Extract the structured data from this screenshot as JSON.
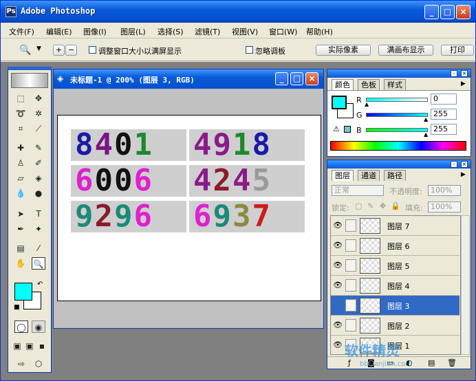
{
  "app": {
    "title": "Adobe Photoshop"
  },
  "menu": [
    "文件(F)",
    "编辑(E)",
    "图像(I)",
    "图层(L)",
    "选择(S)",
    "滤镜(T)",
    "视图(V)",
    "窗口(W)",
    "帮助(H)"
  ],
  "options": {
    "resize_label": "调整窗口大小以满屏显示",
    "ignore_label": "忽略调板",
    "actual_pixels": "实际像素",
    "fit_screen": "满画布显示",
    "print_size": "打印"
  },
  "document": {
    "title": "未标题-1 @ 200% (图层 3, RGB)",
    "cells": [
      {
        "digits": [
          "8",
          "4",
          "0",
          "1"
        ],
        "colors": [
          "#1a1aa8",
          "#7a1585",
          "#111111",
          "#1b8a2a"
        ]
      },
      {
        "digits": [
          "4",
          "9",
          "1",
          "8"
        ],
        "colors": [
          "#8b1b8b",
          "#8b1b8b",
          "#1b8a2a",
          "#1a1aa8"
        ]
      },
      {
        "digits": [
          "6",
          "0",
          "0",
          "6"
        ],
        "colors": [
          "#e020d0",
          "#111111",
          "#111111",
          "#e020d0"
        ]
      },
      {
        "digits": [
          "4",
          "2",
          "4",
          "5"
        ],
        "colors": [
          "#8b1b8b",
          "#8b1b2b",
          "#8b1b8b",
          "#9a9a9a"
        ]
      },
      {
        "digits": [
          "9",
          "2",
          "9",
          "6"
        ],
        "colors": [
          "#1b8a7a",
          "#8b1b2b",
          "#1b8a7a",
          "#e020d0"
        ]
      },
      {
        "digits": [
          "6",
          "9",
          "3",
          "7"
        ],
        "colors": [
          "#e020d0",
          "#1b8a7a",
          "#8a8a40",
          "#d01b1b"
        ]
      }
    ]
  },
  "color_panel": {
    "tabs": [
      "颜色",
      "色板",
      "样式"
    ],
    "r_label": "R",
    "g_label": "G",
    "b_label": "B",
    "r": "0",
    "g": "255",
    "b": "255",
    "foreground": "#00ffff"
  },
  "layers_panel": {
    "tabs": [
      "图层",
      "通道",
      "路径"
    ],
    "blend_mode": "正常",
    "opacity_label": "不透明度:",
    "opacity": "100%",
    "lock_label": "锁定:",
    "fill_label": "填充:",
    "fill": "100%",
    "layers": [
      {
        "name": "图层 7",
        "visible": true,
        "selected": false
      },
      {
        "name": "图层 6",
        "visible": true,
        "selected": false
      },
      {
        "name": "图层 5",
        "visible": true,
        "selected": false
      },
      {
        "name": "图层 4",
        "visible": true,
        "selected": false
      },
      {
        "name": "图层 3",
        "visible": false,
        "selected": true
      },
      {
        "name": "图层 2",
        "visible": true,
        "selected": false
      },
      {
        "name": "图层 1",
        "visible": true,
        "selected": false
      }
    ]
  },
  "watermark": {
    "text": "软件精灵",
    "url": "bbs.anjian.com"
  }
}
